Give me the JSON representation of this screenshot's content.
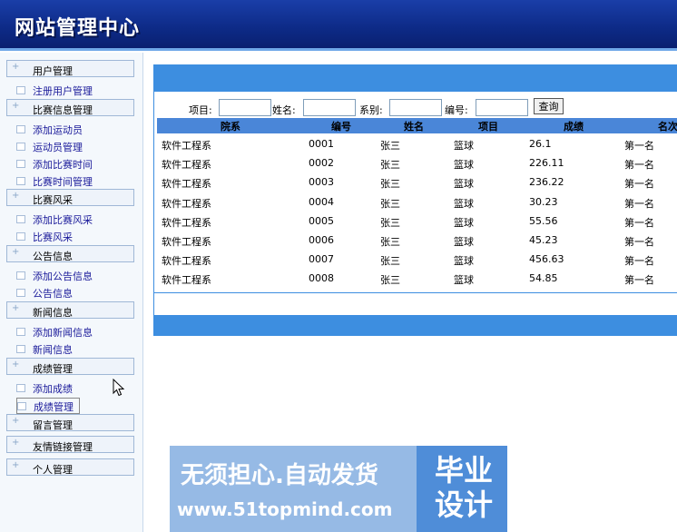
{
  "header": {
    "title": "网站管理中心"
  },
  "sidebar": {
    "categories": [
      {
        "label": "用户管理",
        "items": [
          "注册用户管理"
        ]
      },
      {
        "label": "比赛信息管理",
        "items": [
          "添加运动员",
          "运动员管理",
          "添加比赛时间",
          "比赛时间管理"
        ]
      },
      {
        "label": "比赛风采",
        "items": [
          "添加比赛风采",
          "比赛风采"
        ]
      },
      {
        "label": "公告信息",
        "items": [
          "添加公告信息",
          "公告信息"
        ]
      },
      {
        "label": "新闻信息",
        "items": [
          "添加新闻信息",
          "新闻信息"
        ]
      },
      {
        "label": "成绩管理",
        "items": [
          "添加成绩",
          "成绩管理"
        ]
      },
      {
        "label": "留言管理",
        "items": []
      },
      {
        "label": "友情链接管理",
        "items": []
      },
      {
        "label": "个人管理",
        "items": []
      }
    ]
  },
  "search": {
    "project_label": "项目:",
    "name_label": "姓名:",
    "dept_label": "系别:",
    "number_label": "编号:",
    "button_label": "查询"
  },
  "table": {
    "headers": [
      "院系",
      "编号",
      "姓名",
      "项目",
      "成绩",
      "名次"
    ],
    "rows": [
      [
        "软件工程系",
        "0001",
        "张三",
        "篮球",
        "26.1",
        "第一名"
      ],
      [
        "软件工程系",
        "0002",
        "张三",
        "篮球",
        "226.11",
        "第一名"
      ],
      [
        "软件工程系",
        "0003",
        "张三",
        "篮球",
        "236.22",
        "第一名"
      ],
      [
        "软件工程系",
        "0004",
        "张三",
        "篮球",
        "30.23",
        "第一名"
      ],
      [
        "软件工程系",
        "0005",
        "张三",
        "篮球",
        "55.56",
        "第一名"
      ],
      [
        "软件工程系",
        "0006",
        "张三",
        "篮球",
        "45.23",
        "第一名"
      ],
      [
        "软件工程系",
        "0007",
        "张三",
        "篮球",
        "456.63",
        "第一名"
      ],
      [
        "软件工程系",
        "0008",
        "张三",
        "篮球",
        "54.85",
        "第一名"
      ]
    ]
  },
  "watermark": {
    "line1": "无须担心.自动发货",
    "line2": "www.51topmind.com",
    "badge": "毕业设计"
  },
  "icons": {
    "category": "plus-icon",
    "item": "square-icon",
    "cursor": "mouse-pointer-icon"
  }
}
